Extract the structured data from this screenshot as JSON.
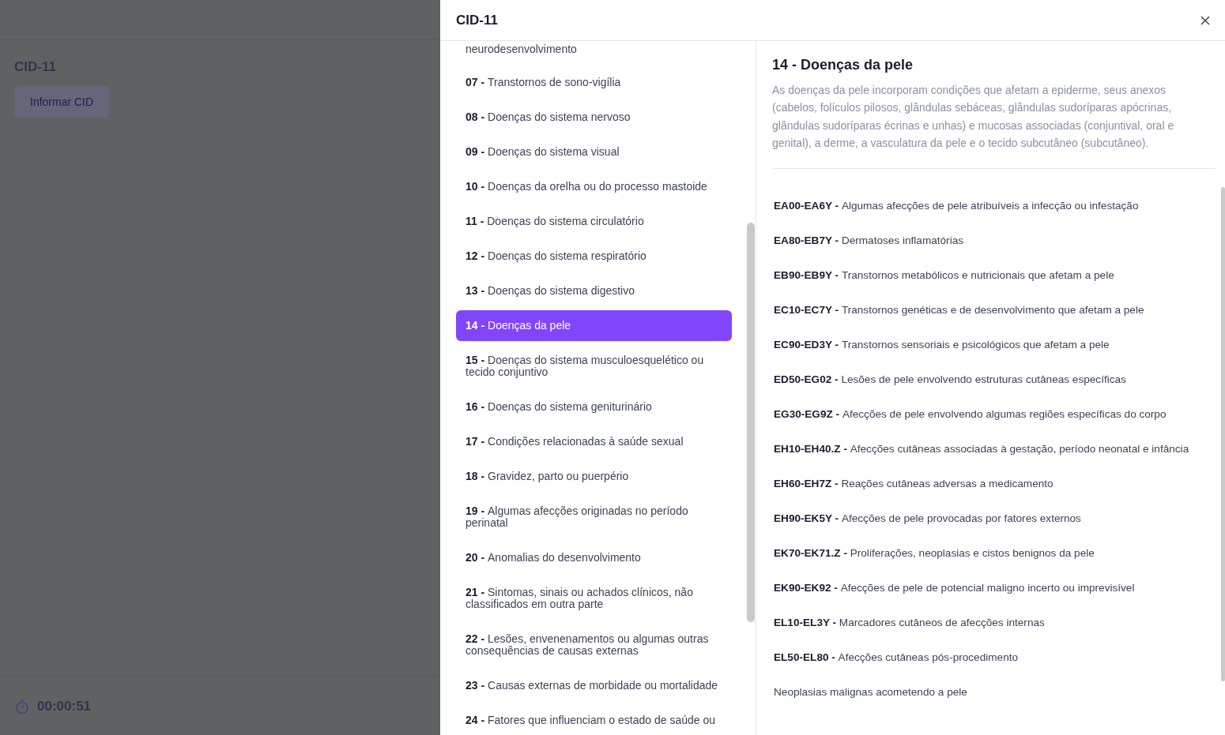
{
  "background_page": {
    "title": "CID-11",
    "button": "Informar CID",
    "timer": "00:00:51"
  },
  "drawer": {
    "title": "CID-11",
    "chapters": [
      {
        "label": "neurodesenvolvimento",
        "selected": false
      },
      {
        "code": "07 -",
        "label": "Transtornos de sono-vigília",
        "selected": false
      },
      {
        "code": "08 -",
        "label": "Doenças do sistema nervoso",
        "selected": false
      },
      {
        "code": "09 -",
        "label": "Doenças do sistema visual",
        "selected": false
      },
      {
        "code": "10 -",
        "label": "Doenças da orelha ou do processo mastoide",
        "selected": false
      },
      {
        "code": "11 -",
        "label": "Doenças do sistema circulatório",
        "selected": false
      },
      {
        "code": "12 -",
        "label": "Doenças do sistema respiratório",
        "selected": false
      },
      {
        "code": "13 -",
        "label": "Doenças do sistema digestivo",
        "selected": false
      },
      {
        "code": "14 -",
        "label": "Doenças da pele",
        "selected": true
      },
      {
        "code": "15 -",
        "label": "Doenças do sistema musculoesquelético ou tecido conjuntivo",
        "selected": false
      },
      {
        "code": "16 -",
        "label": "Doenças do sistema geniturinário",
        "selected": false
      },
      {
        "code": "17 -",
        "label": "Condições relacionadas à saúde sexual",
        "selected": false
      },
      {
        "code": "18 -",
        "label": "Gravidez, parto ou puerpério",
        "selected": false
      },
      {
        "code": "19 -",
        "label": "Algumas afecções originadas no período perinatal",
        "selected": false
      },
      {
        "code": "20 -",
        "label": "Anomalias do desenvolvimento",
        "selected": false
      },
      {
        "code": "21 -",
        "label": "Sintomas, sinais ou achados clínicos, não classificados em outra parte",
        "selected": false
      },
      {
        "code": "22 -",
        "label": "Lesões, envenenamentos ou algumas outras consequências de causas externas",
        "selected": false
      },
      {
        "code": "23 -",
        "label": "Causas externas de morbidade ou mortalidade",
        "selected": false
      },
      {
        "code": "24 -",
        "label": "Fatores que influenciam o estado de saúde ou",
        "selected": false
      }
    ],
    "detail": {
      "heading": "14 - Doenças da pele",
      "description": "As doenças da pele incorporam condições que afetam a epiderme, seus anexos (cabelos, folículos pilosos, glândulas sebáceas, glândulas sudoríparas apócrinas, glândulas sudoríparas écrinas e unhas) e mucosas associadas (conjuntival, oral e genital), a derme, a vasculatura da pele e o tecido subcutâneo (subcutâneo).",
      "blocks": [
        {
          "code": "EA00-EA6Y -",
          "label": "Algumas afecções de pele atribuíveis a infecção ou infestação"
        },
        {
          "code": "EA80-EB7Y -",
          "label": "Dermatoses inflamatórias"
        },
        {
          "code": "EB90-EB9Y -",
          "label": "Transtornos metabólicos e nutricionais que afetam a pele"
        },
        {
          "code": "EC10-EC7Y -",
          "label": "Transtornos genéticas e de desenvolvimento que afetam a pele"
        },
        {
          "code": "EC90-ED3Y -",
          "label": "Transtornos sensoriais e psicológicos que afetam a pele"
        },
        {
          "code": "ED50-EG02 -",
          "label": "Lesões de pele envolvendo estruturas cutâneas específicas"
        },
        {
          "code": "EG30-EG9Z -",
          "label": "Afecções de pele envolvendo algumas regiões específicas do corpo"
        },
        {
          "code": "EH10-EH40.Z -",
          "label": "Afecções cutâneas associadas à gestação, período neonatal e infância"
        },
        {
          "code": "EH60-EH7Z -",
          "label": "Reações cutâneas adversas a medicamento"
        },
        {
          "code": "EH90-EK5Y -",
          "label": "Afecções de pele provocadas por fatores externos"
        },
        {
          "code": "EK70-EK71.Z -",
          "label": "Proliferações, neoplasias e cistos benignos da pele"
        },
        {
          "code": "EK90-EK92 -",
          "label": "Afecções de pele de potencial maligno incerto ou imprevisível"
        },
        {
          "code": "EL10-EL3Y -",
          "label": "Marcadores cutâneos de afecções internas"
        },
        {
          "code": "EL50-EL80 -",
          "label": "Afecções cutâneas pós-procedimento"
        },
        {
          "label": "Neoplasias malignas acometendo a pele"
        }
      ]
    }
  }
}
